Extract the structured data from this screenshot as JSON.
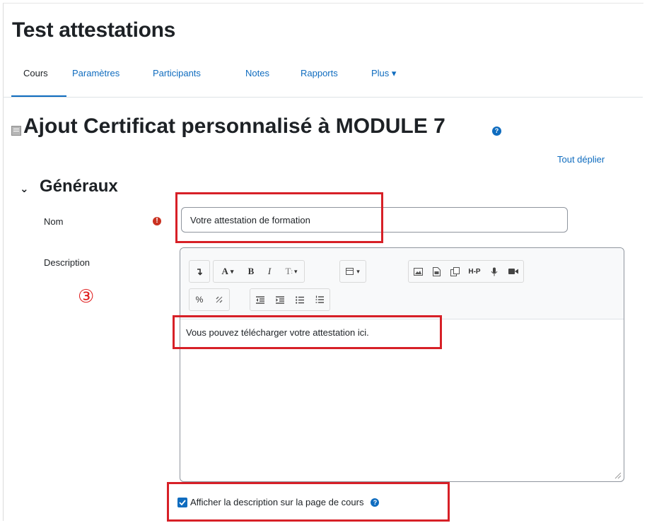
{
  "course": {
    "title": "Test attestations"
  },
  "nav": {
    "tabs": [
      {
        "label": "Cours"
      },
      {
        "label": "Paramètres"
      },
      {
        "label": "Participants"
      },
      {
        "label": "Notes"
      },
      {
        "label": "Rapports"
      },
      {
        "label": "Plus ▾"
      }
    ]
  },
  "page": {
    "title": "Ajout Certificat personnalisé à MODULE 7",
    "expand_all": "Tout déplier"
  },
  "section": {
    "title": "Généraux",
    "chevron": "⌄"
  },
  "form": {
    "name_label": "Nom",
    "name_value": "Votre attestation de formation",
    "description_label": "Description",
    "description_text": "Vous pouvez télécharger votre attestation ici.",
    "show_description_label": "Afficher la description sur la page de cours",
    "show_description_checked": true
  },
  "annotation": {
    "step": "③",
    "color": "#d72027"
  },
  "colors": {
    "accent": "#0f6cbf",
    "required": "#ca3120"
  }
}
